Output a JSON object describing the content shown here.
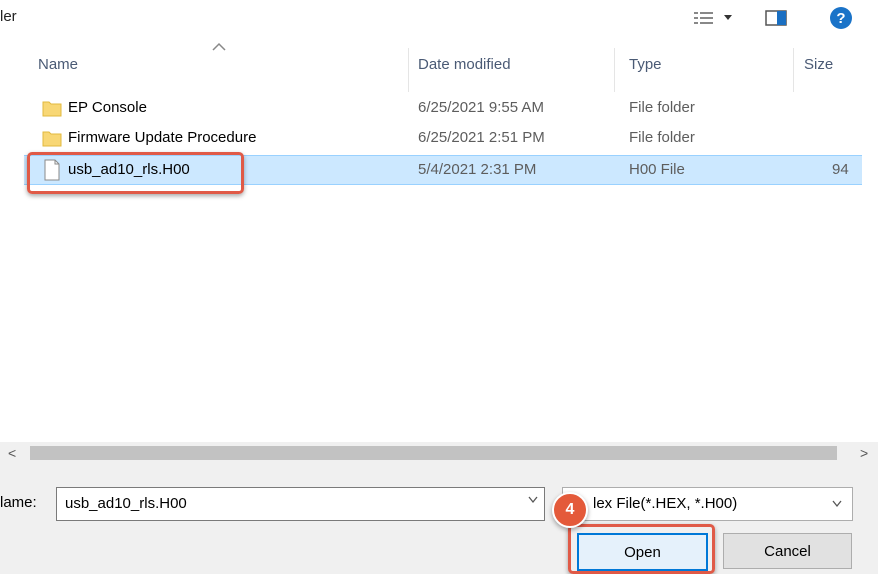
{
  "window": {
    "title_fragment": "ler"
  },
  "toolbar": {
    "view_icon": "details-view-icon",
    "pane_icon": "preview-pane-icon",
    "help_label": "?"
  },
  "columns": {
    "name": "Name",
    "date": "Date modified",
    "type": "Type",
    "size": "Size"
  },
  "files": [
    {
      "name": "EP Console",
      "date": "6/25/2021 9:55 AM",
      "type": "File folder",
      "size": "",
      "icon": "folder-icon"
    },
    {
      "name": "Firmware Update Procedure",
      "date": "6/25/2021 2:51 PM",
      "type": "File folder",
      "size": "",
      "icon": "folder-icon"
    },
    {
      "name": "usb_ad10_rls.H00",
      "date": "5/4/2021 2:31 PM",
      "type": "H00 File",
      "size": "94",
      "icon": "file-icon",
      "selected": true
    }
  ],
  "scrollbar": {
    "left_arrow": "<",
    "right_arrow": ">"
  },
  "footer": {
    "filename_label": "lame:",
    "filename_value": "usb_ad10_rls.H00",
    "filetype_value": "lex File(*.HEX, *.H00)",
    "open_label": "Open",
    "cancel_label": "Cancel"
  },
  "annotation": {
    "step_number": "4"
  },
  "colors": {
    "selection": "#cce8ff",
    "highlight_box": "#e05a47",
    "badge": "#e45a3a",
    "folder": "#f8d775"
  }
}
